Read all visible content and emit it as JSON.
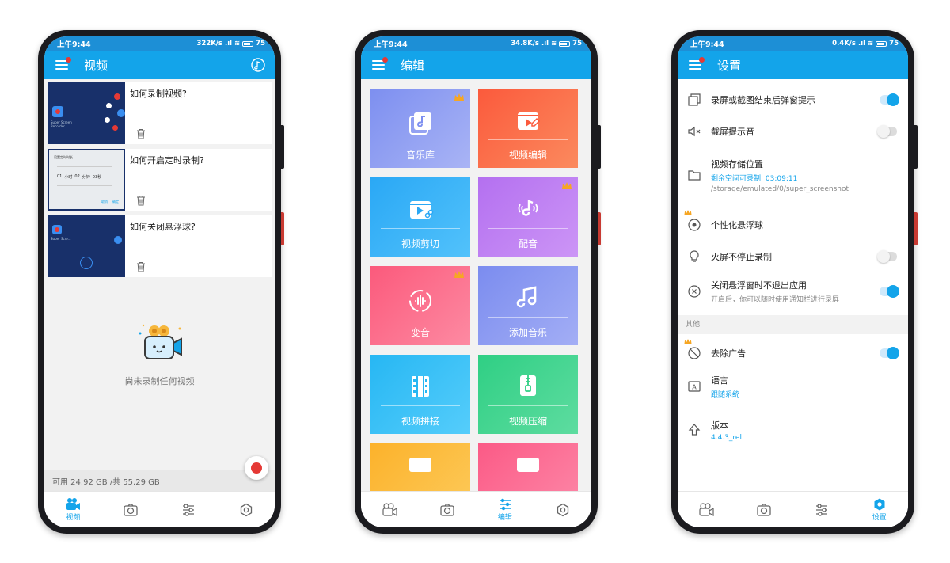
{
  "colors": {
    "accent": "#13a4ea",
    "status_bar": "#1d8fd6",
    "record": "#e53935",
    "crown": "#f6a623"
  },
  "phone1": {
    "status": {
      "time": "上午9:44",
      "speed": "322K/s",
      "battery": "75"
    },
    "title": "视频",
    "videos": [
      {
        "title": "如何录制视频?"
      },
      {
        "title": "如何开启定时录制?"
      },
      {
        "title": "如何关闭悬浮球?"
      }
    ],
    "thumb1": {
      "name": "Super Screen Recorder"
    },
    "thumb2": {
      "title": "设置定时时长",
      "time_parts": [
        "01",
        "小时",
        "02",
        "分钟",
        "03秒"
      ],
      "cancel": "取消",
      "ok": "确定"
    },
    "thumb3": {
      "name": "Super Scre..."
    },
    "empty_text": "尚未录制任何视频",
    "storage": "可用 24.92 GB /共 55.29 GB",
    "nav": {
      "video": "视频"
    }
  },
  "phone2": {
    "status": {
      "time": "上午9:44",
      "speed": "34.8K/s",
      "battery": "75"
    },
    "title": "编辑",
    "tiles": [
      {
        "label": "音乐库",
        "icon": "music-library-icon",
        "crown": true
      },
      {
        "label": "视频编辑",
        "icon": "video-edit-icon",
        "crown": false
      },
      {
        "label": "视频剪切",
        "icon": "video-cut-icon",
        "crown": false
      },
      {
        "label": "配音",
        "icon": "dubbing-icon",
        "crown": true
      },
      {
        "label": "变音",
        "icon": "voice-change-icon",
        "crown": true
      },
      {
        "label": "添加音乐",
        "icon": "add-music-icon",
        "crown": false
      },
      {
        "label": "视频拼接",
        "icon": "video-merge-icon",
        "crown": false
      },
      {
        "label": "视频压缩",
        "icon": "video-compress-icon",
        "crown": false
      }
    ],
    "nav": {
      "edit": "编辑"
    }
  },
  "phone3": {
    "status": {
      "time": "上午9:44",
      "speed": "0.4K/s",
      "battery": "75"
    },
    "title": "设置",
    "settings": {
      "popup": {
        "label": "录屏或截图结束后弹窗提示",
        "on": true
      },
      "screenshot_sound": {
        "label": "截屏提示音",
        "on": false
      },
      "storage": {
        "label": "视频存储位置",
        "remaining": "剩余空间可录制: 03:09:11",
        "path": "/storage/emulated/0/super_screenshot"
      },
      "floating_ball": {
        "label": "个性化悬浮球"
      },
      "screen_off": {
        "label": "灭屏不停止录制",
        "on": false
      },
      "close_float": {
        "label": "关闭悬浮窗时不退出应用",
        "sub": "开启后，你可以随时使用通知栏进行录屏",
        "on": true
      },
      "section_other": "其他",
      "remove_ads": {
        "label": "去除广告",
        "on": true
      },
      "language": {
        "label": "语言",
        "value": "跟随系统"
      },
      "version": {
        "label": "版本",
        "value": "4.4.3_rel"
      }
    },
    "nav": {
      "settings": "设置"
    }
  }
}
